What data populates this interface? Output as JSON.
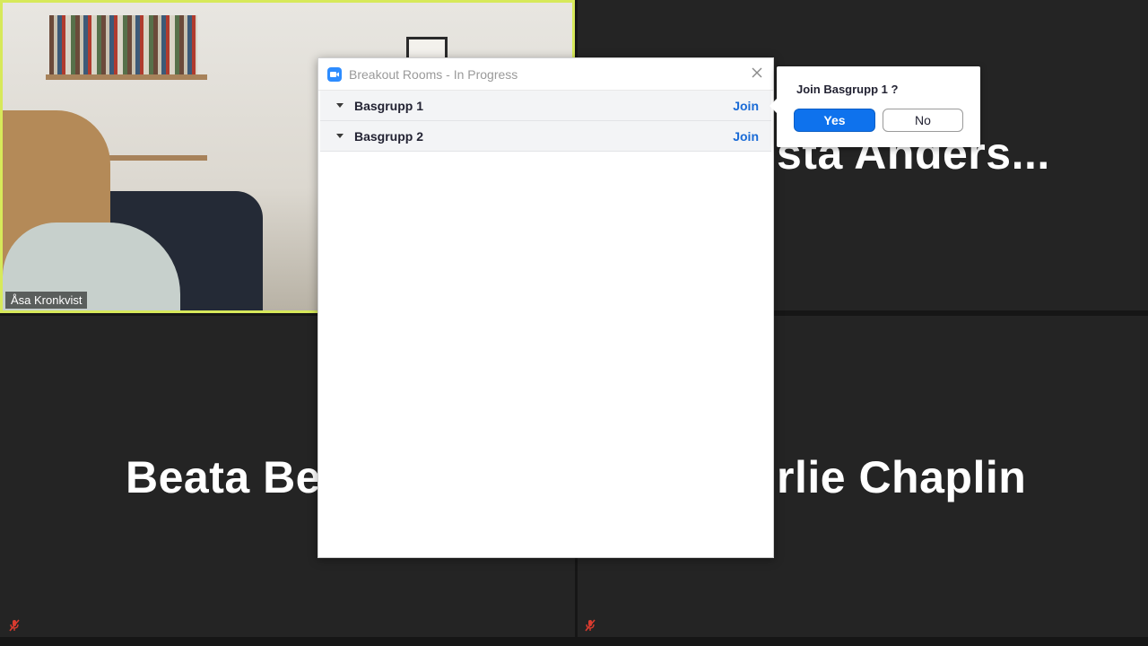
{
  "participants": {
    "camera_tile_label": "Åsa Kronkvist",
    "tile_top_right_name": "sta  Anders...",
    "tile_bottom_left_name": "Beata Be",
    "tile_bottom_right_name": "rlie Chaplin"
  },
  "breakout_dialog": {
    "title": "Breakout Rooms - In Progress",
    "rooms": [
      {
        "name": "Basgrupp 1",
        "join_label": "Join"
      },
      {
        "name": "Basgrupp 2",
        "join_label": "Join"
      }
    ]
  },
  "confirm_popover": {
    "question": "Join Basgrupp 1 ?",
    "yes_label": "Yes",
    "no_label": "No"
  },
  "colors": {
    "active_speaker_border": "#d7e95a",
    "join_link": "#1a6bd6",
    "primary_button": "#0e72ed",
    "muted_icon": "#d93b2f"
  },
  "icons": [
    "zoom-app-icon",
    "close-icon",
    "caret-down-icon",
    "muted-microphone-icon"
  ]
}
